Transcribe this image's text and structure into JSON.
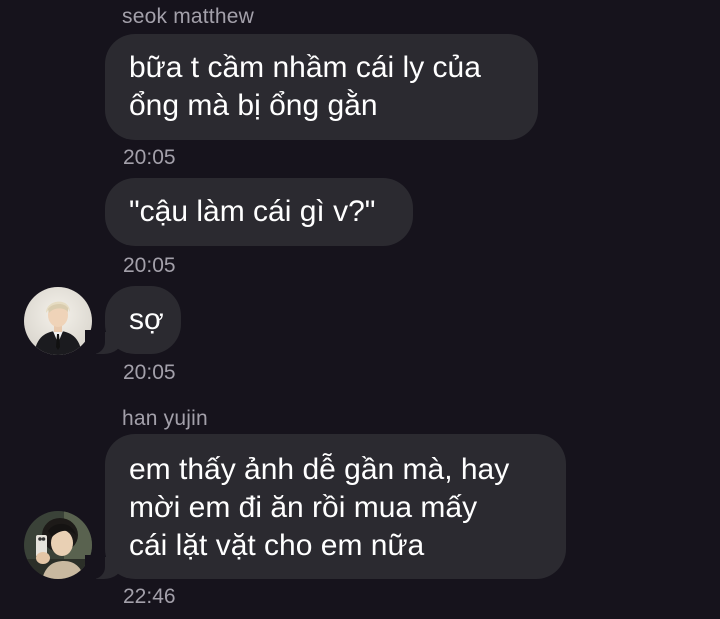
{
  "messages": [
    {
      "sender": "seok matthew",
      "lines": [
        "bữa t cầm nhầm cái ly của",
        "ổng mà bị ổng gằn"
      ],
      "time": "20:05"
    },
    {
      "lines": [
        "\"cậu làm cái gì v?\""
      ],
      "time": "20:05"
    },
    {
      "lines": [
        "sợ"
      ],
      "time": "20:05"
    },
    {
      "sender": "han yujin",
      "lines": [
        "em thấy ảnh dễ gần mà, hay",
        "mời em đi ăn rồi mua mấy",
        "cái lặt vặt cho em nữa"
      ],
      "time": "22:46"
    }
  ],
  "colors": {
    "background": "#16131c",
    "bubble": "#2b2a30",
    "meta_text": "#a3a0aa",
    "message_text": "#ffffff"
  },
  "icons": {
    "avatar_1": "profile-photo-suit",
    "avatar_2": "profile-photo-mirror-selfie"
  }
}
